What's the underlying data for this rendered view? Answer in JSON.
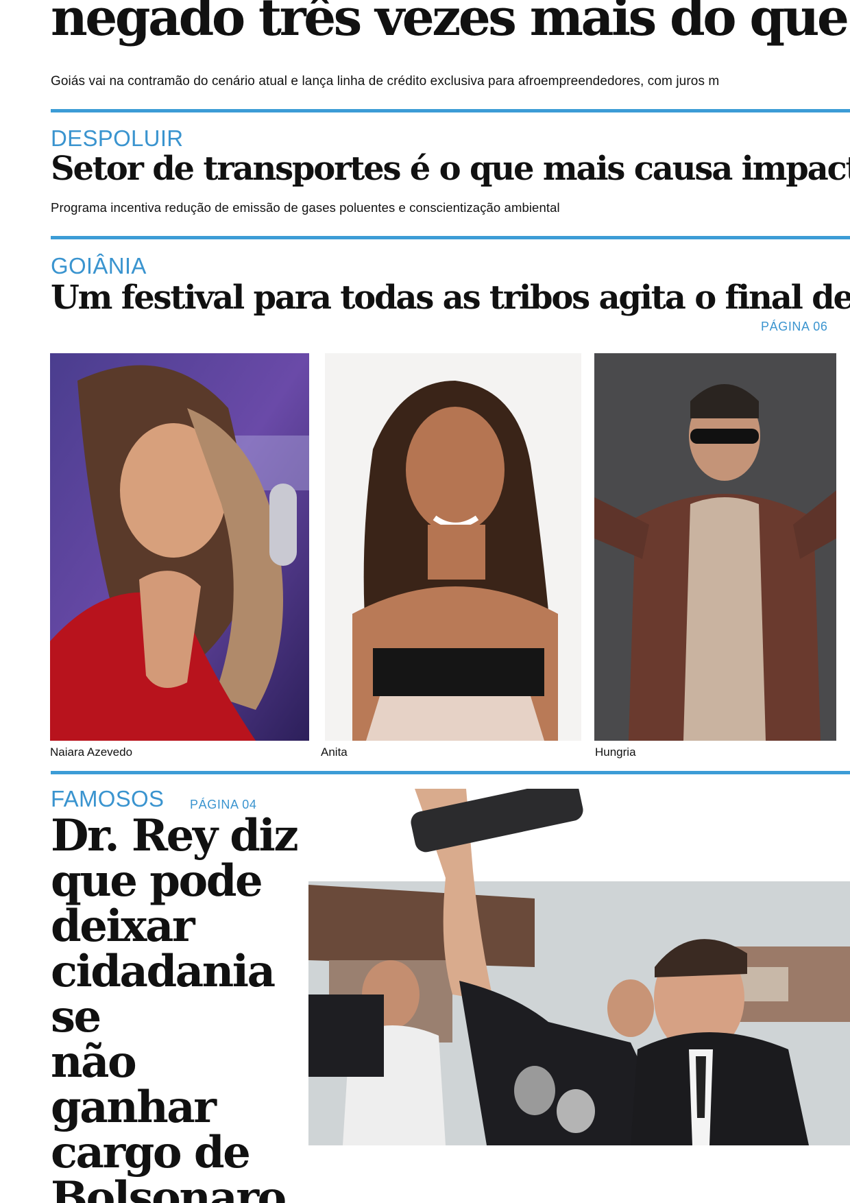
{
  "lead": {
    "headline": "negado três vezes mais do que os",
    "subhead": "Goiás vai na contramão do cenário atual e lança linha de crédito exclusiva para afroempreendedores, com juros m"
  },
  "despoluir": {
    "section": "DESPOLUIR",
    "headline": "Setor de transportes é o que mais causa impactos na",
    "subhead": "Programa incentiva redução de emissão de gases poluentes e conscientização ambiental"
  },
  "goiania": {
    "section": "GOIÂNIA",
    "headline": "Um festival para todas as tribos agita o final de ano",
    "page_ref": "PÁGINA 06",
    "photos": [
      {
        "caption": "Naiara Azevedo"
      },
      {
        "caption": "Anita"
      },
      {
        "caption": "Hungria"
      }
    ]
  },
  "famosos": {
    "section": "FAMOSOS",
    "page_ref": "PÁGINA 04",
    "headline_lines": [
      "Dr. Rey diz",
      "que pode",
      "deixar",
      "cidadania se",
      "não ganhar",
      "cargo de",
      "Bolsonaro"
    ]
  },
  "colors": {
    "accent": "#3c9cd6",
    "text": "#111111"
  }
}
